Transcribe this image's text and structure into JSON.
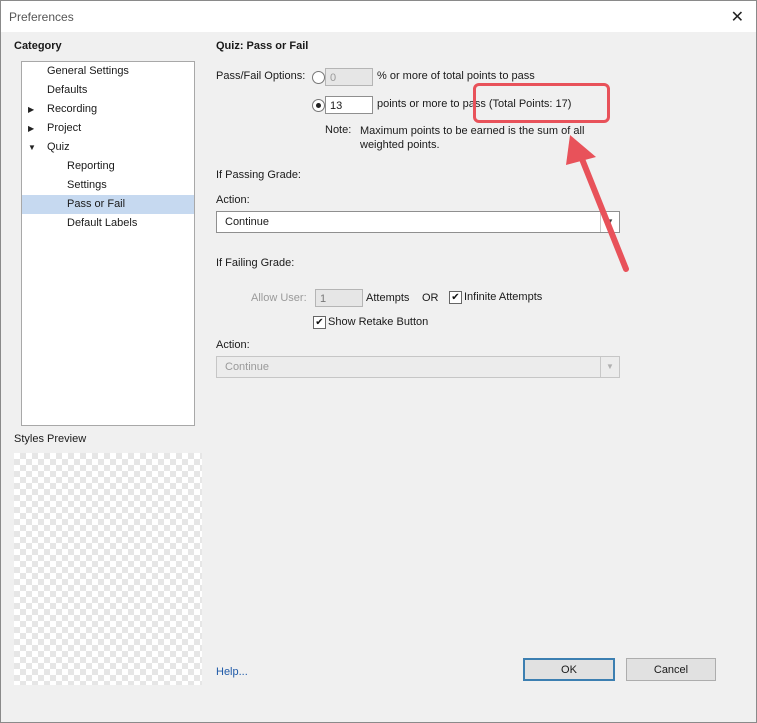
{
  "window": {
    "title": "Preferences",
    "close_glyph": "✕"
  },
  "sidebar": {
    "category_label": "Category",
    "items": [
      {
        "label": "General Settings"
      },
      {
        "label": "Defaults"
      },
      {
        "label": "Recording",
        "expander": "▶"
      },
      {
        "label": "Project",
        "expander": "▶"
      },
      {
        "label": "Quiz",
        "expander": "▼"
      },
      {
        "label": "Reporting"
      },
      {
        "label": "Settings"
      },
      {
        "label": "Pass or Fail",
        "selected": true
      },
      {
        "label": "Default Labels"
      }
    ],
    "styles_preview_label": "Styles Preview"
  },
  "main": {
    "title": "Quiz: Pass or Fail",
    "options_label": "Pass/Fail Options:",
    "percent_option": {
      "value": "0",
      "text": "% or more of total points to pass",
      "selected": false
    },
    "points_option": {
      "value": "13",
      "text": "points or more to pass (Total Points: 17)",
      "selected": true
    },
    "note_label": "Note:",
    "note_text": "Maximum points to be earned is the sum of all weighted points.",
    "passing": {
      "heading": "If Passing Grade:",
      "action_label": "Action:",
      "action_value": "Continue"
    },
    "failing": {
      "heading": "If Failing Grade:",
      "allow_user_label": "Allow User:",
      "attempts_value": "1",
      "attempts_label": "Attempts",
      "or_label": "OR",
      "infinite_attempts": {
        "label": "Infinite Attempts",
        "checked": true
      },
      "show_retake": {
        "label": "Show Retake Button",
        "checked": true
      },
      "action_label": "Action:",
      "action_value": "Continue"
    }
  },
  "footer": {
    "help_link": "Help...",
    "ok_label": "OK",
    "cancel_label": "Cancel"
  },
  "colors": {
    "annotation": "#e8525a",
    "selection": "#c6d9f0",
    "link": "#1f5aa8"
  },
  "check_glyph": "✔",
  "arrow_glyph": "▼"
}
